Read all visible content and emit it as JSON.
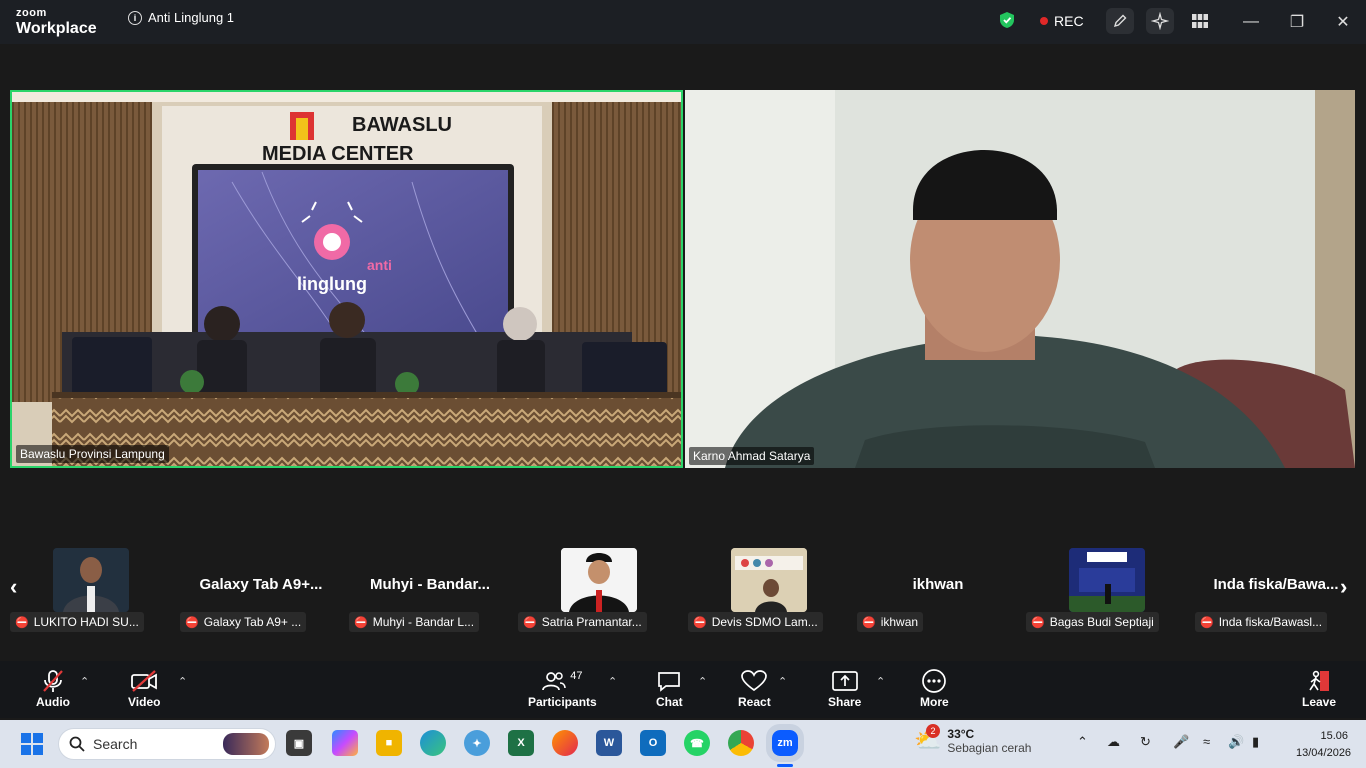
{
  "app": {
    "brand_small": "zoom",
    "brand_large": "Workplace",
    "meeting_title": "Anti Linglung 1",
    "rec_label": "REC"
  },
  "tiles": [
    {
      "name": "Bawaslu Provinsi Lampung",
      "sign_top": "BAWASLU",
      "sign_bottom": "MEDIA CENTER",
      "screen_text_1": "anti",
      "screen_text_2": "linglung"
    },
    {
      "name": "Karno Ahmad Satarya"
    }
  ],
  "thumbs": [
    {
      "label": "LUKITO HADI SU...",
      "type": "video"
    },
    {
      "label": "Galaxy Tab A9+ ...",
      "big": "Galaxy Tab A9+...",
      "type": "name"
    },
    {
      "label": "Muhyi - Bandar L...",
      "big": "Muhyi - Bandar...",
      "type": "name"
    },
    {
      "label": "Satria Pramantar...",
      "type": "video"
    },
    {
      "label": "Devis SDMO Lam...",
      "type": "video"
    },
    {
      "label": "ikhwan",
      "big": "ikhwan",
      "type": "name"
    },
    {
      "label": "Bagas Budi Septiaji",
      "type": "video"
    },
    {
      "label": "Inda fiska/Bawasl...",
      "big": "Inda fiska/Bawa...",
      "type": "name"
    }
  ],
  "toolbar": {
    "audio": "Audio",
    "video": "Video",
    "participants": "Participants",
    "participants_count": "47",
    "chat": "Chat",
    "react": "React",
    "share": "Share",
    "more": "More",
    "leave": "Leave"
  },
  "taskbar": {
    "search_placeholder": "Search",
    "weather_temp": "33°C",
    "weather_desc": "Sebagian cerah",
    "weather_badge": "2",
    "time": "15.06",
    "date": "13/04/2026"
  }
}
